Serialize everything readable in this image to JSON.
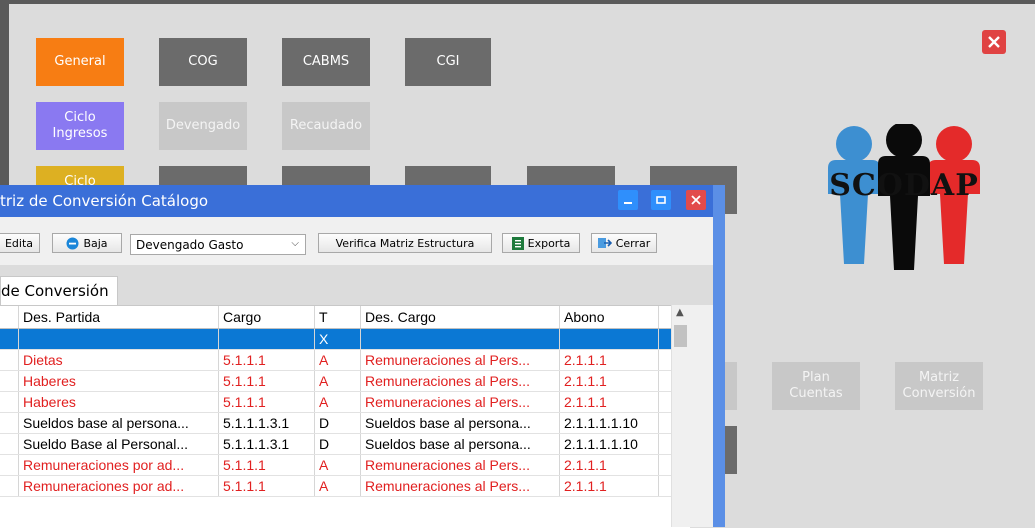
{
  "tiles": {
    "general": "General",
    "cog": "COG",
    "cabms": "CABMS",
    "cgi": "CGI",
    "ciclo_ingresos": "Ciclo\nIngresos",
    "devengado": "Devengado",
    "recaudado": "Recaudado",
    "ciclo_partial": "Ciclo",
    "plan_cuentas": "Plan\nCuentas",
    "matriz_conversion": "Matriz\nConversión"
  },
  "logo": {
    "text": "SCODAP"
  },
  "dialog": {
    "title": "triz de Conversión Catálogo",
    "toolbar": {
      "edita": "Edita",
      "baja": "Baja",
      "select_value": "Devengado Gasto",
      "verifica": "Verifica Matriz Estructura",
      "exporta": "Exporta",
      "cerrar": "Cerrar"
    },
    "tab_label": "de Conversión",
    "columns": [
      "Des. Partida",
      "Cargo",
      "T",
      "Des. Cargo",
      "Abono"
    ],
    "rows": [
      {
        "des_partida": "",
        "cargo": "",
        "t": "X",
        "des_cargo": "",
        "abono": "",
        "style": "sel"
      },
      {
        "des_partida": "Dietas",
        "cargo": "5.1.1.1",
        "t": "A",
        "des_cargo": "Remuneraciones al Pers...",
        "abono": "2.1.1.1",
        "style": "red"
      },
      {
        "des_partida": "Haberes",
        "cargo": "5.1.1.1",
        "t": "A",
        "des_cargo": "Remuneraciones al Pers...",
        "abono": "2.1.1.1",
        "style": "red"
      },
      {
        "des_partida": "Haberes",
        "cargo": "5.1.1.1",
        "t": "A",
        "des_cargo": "Remuneraciones al Pers...",
        "abono": "2.1.1.1",
        "style": "red"
      },
      {
        "des_partida": "Sueldos base al persona...",
        "cargo": "5.1.1.1.3.1",
        "t": "D",
        "des_cargo": "Sueldos base al persona...",
        "abono": "2.1.1.1.1.10",
        "style": "blk"
      },
      {
        "des_partida": "Sueldo Base al Personal...",
        "cargo": "5.1.1.1.3.1",
        "t": "D",
        "des_cargo": "Sueldos base al persona...",
        "abono": "2.1.1.1.1.10",
        "style": "blk"
      },
      {
        "des_partida": "Remuneraciones por ad...",
        "cargo": "5.1.1.1",
        "t": "A",
        "des_cargo": "Remuneraciones al Pers...",
        "abono": "2.1.1.1",
        "style": "red"
      },
      {
        "des_partida": "Remuneraciones por ad...",
        "cargo": "5.1.1.1",
        "t": "A",
        "des_cargo": "Remuneraciones al Pers...",
        "abono": "2.1.1.1",
        "style": "red"
      }
    ]
  },
  "colors": {
    "accent_orange": "#f77d13",
    "title_blue": "#3a6fd8",
    "selection": "#0b78d4",
    "error_red": "#e12020"
  }
}
